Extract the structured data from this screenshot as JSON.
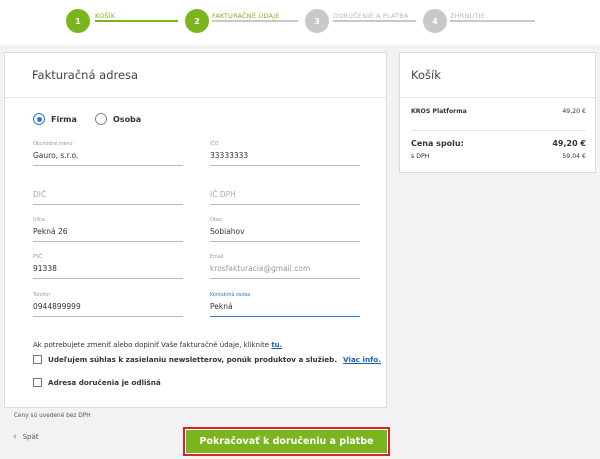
{
  "stepper": {
    "steps": [
      {
        "number": "1",
        "label": "KOŠÍK"
      },
      {
        "number": "2",
        "label": "FAKTURAČNÉ ÚDAJE"
      },
      {
        "number": "3",
        "label": "DORUČENIE A PLATBA"
      },
      {
        "number": "4",
        "label": "ZHRNUTIE"
      }
    ],
    "colors": {
      "active": "#7ab51d",
      "inactive": "#c8c8c8"
    }
  },
  "billing": {
    "title": "Fakturačná adresa",
    "type_options": [
      {
        "label": "Firma",
        "selected": true
      },
      {
        "label": "Osoba",
        "selected": false
      }
    ],
    "fields": {
      "company_name": {
        "label": "Obchodné meno",
        "value": "Gauro, s.r.o."
      },
      "ico": {
        "label": "IČO",
        "value": "33333333"
      },
      "dic": {
        "placeholder": "DIČ",
        "value": ""
      },
      "ic_dph": {
        "placeholder": "IČ DPH",
        "value": ""
      },
      "street": {
        "label": "Ulica",
        "value": "Pekná 26"
      },
      "city": {
        "label": "Obec",
        "value": "Sobiahov"
      },
      "zip": {
        "label": "PSČ",
        "value": "91338"
      },
      "email": {
        "label": "Email",
        "value": "krosfakturacia@gmail.com"
      },
      "phone": {
        "label": "Telefón",
        "value": "0944899999"
      },
      "contact_person": {
        "label": "Kontaktná osoba",
        "value": "Pekná"
      }
    },
    "info_text": "Ak potrebujete zmeniť alebo doplniť Vaše fakturačné údaje, kliknite",
    "info_link": "tu.",
    "newsletter_label": "Udeľujem súhlas k zasielaniu newsletterov, ponúk produktov a služieb.",
    "newsletter_checked": false,
    "more_info_link": "Viac info.",
    "different_delivery_label": "Adresa doručenia je odlišná",
    "different_delivery_checked": false
  },
  "cart": {
    "title": "Košík",
    "items": [
      {
        "name": "KROS Platforma",
        "price": "49,20 €"
      }
    ],
    "total_label": "Cena spolu:",
    "total_value": "49,20 €",
    "vat_label": "s DPH",
    "vat_value": "59,04 €"
  },
  "footer": {
    "prices_note": "Ceny sú uvedené bez DPH",
    "back_label": "Späť",
    "continue_label": "Pokračovať k doručeniu a platbe",
    "accent_color": "#7ab51d",
    "highlight_border_color": "#d8252b"
  }
}
